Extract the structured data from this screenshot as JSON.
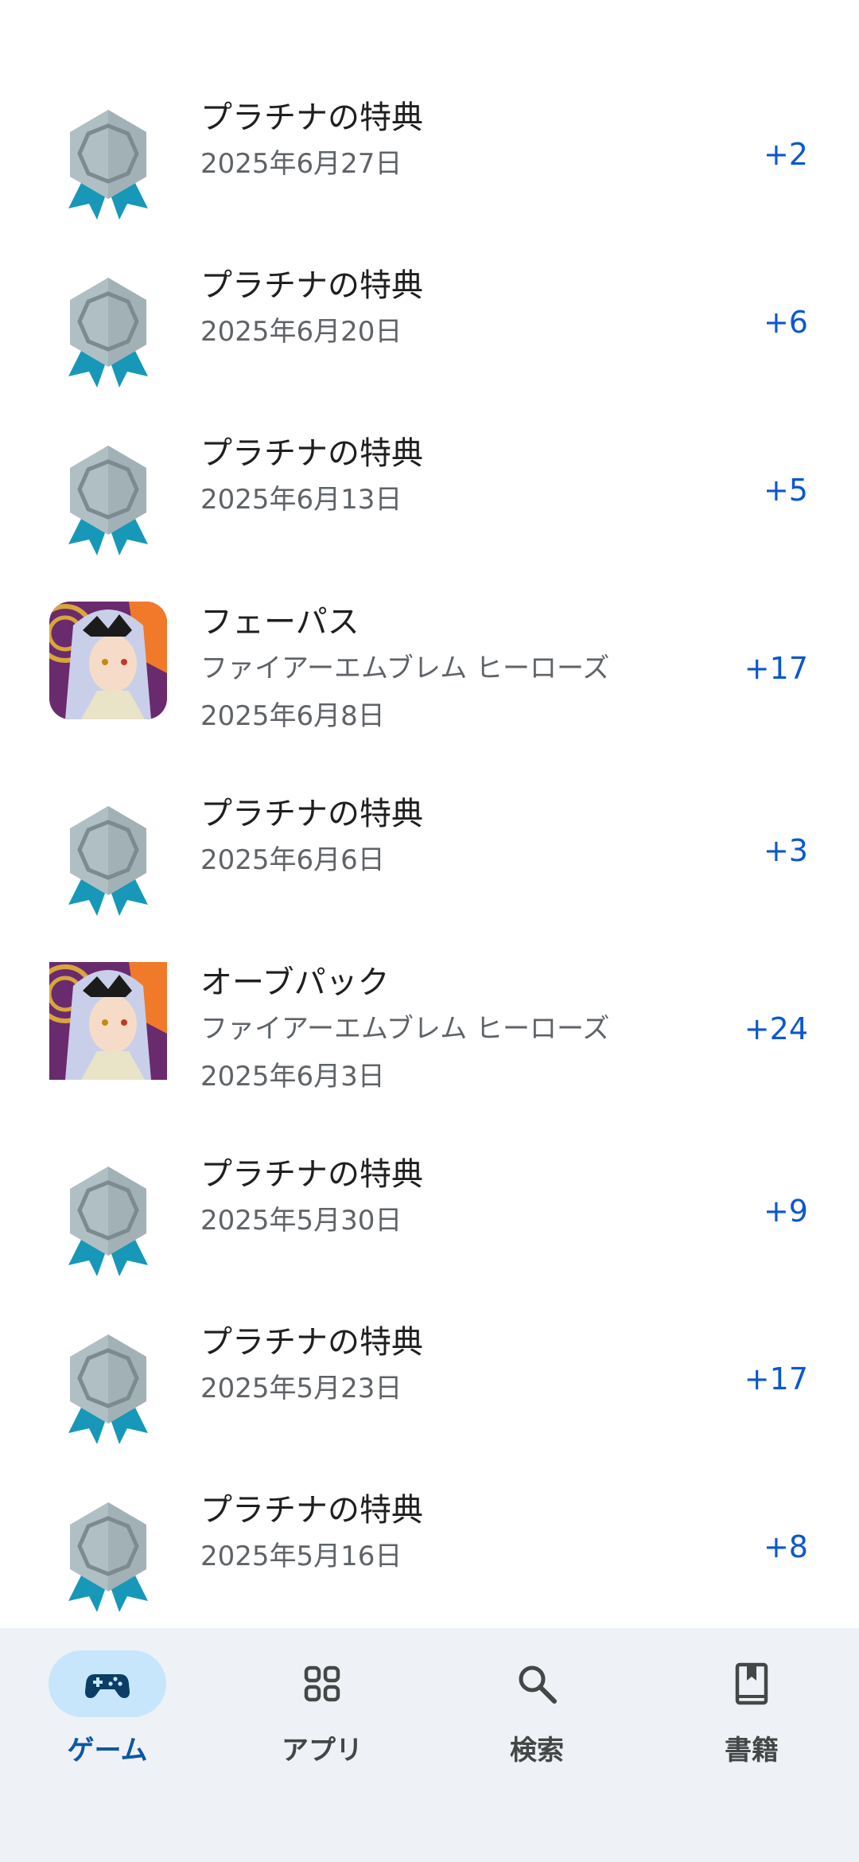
{
  "items": [
    {
      "title": "プラチナの特典",
      "subtitle": "",
      "date": "2025年6月27日",
      "points": "+2",
      "icon": "platinum-medal-icon"
    },
    {
      "title": "プラチナの特典",
      "subtitle": "",
      "date": "2025年6月20日",
      "points": "+6",
      "icon": "platinum-medal-icon"
    },
    {
      "title": "プラチナの特典",
      "subtitle": "",
      "date": "2025年6月13日",
      "points": "+5",
      "icon": "platinum-medal-icon"
    },
    {
      "title": "フェーパス",
      "subtitle": "ファイアーエムブレム ヒーローズ",
      "date": "2025年6月8日",
      "points": "+17",
      "icon": "game-app-icon"
    },
    {
      "title": "プラチナの特典",
      "subtitle": "",
      "date": "2025年6月6日",
      "points": "+3",
      "icon": "platinum-medal-icon"
    },
    {
      "title": "オーブパック",
      "subtitle": "ファイアーエムブレム ヒーローズ",
      "date": "2025年6月3日",
      "points": "+24",
      "icon": "game-app-icon"
    },
    {
      "title": "プラチナの特典",
      "subtitle": "",
      "date": "2025年5月30日",
      "points": "+9",
      "icon": "platinum-medal-icon"
    },
    {
      "title": "プラチナの特典",
      "subtitle": "",
      "date": "2025年5月23日",
      "points": "+17",
      "icon": "platinum-medal-icon"
    },
    {
      "title": "プラチナの特典",
      "subtitle": "",
      "date": "2025年5月16日",
      "points": "+8",
      "icon": "platinum-medal-icon"
    }
  ],
  "nav": {
    "games": "ゲーム",
    "apps": "アプリ",
    "search": "検索",
    "books": "書籍"
  },
  "colors": {
    "points": "#0b57d0",
    "nav_background": "#eef1f6",
    "nav_active_pill": "#c7e6fb",
    "medal_silver": "#b0bfc4",
    "medal_ribbon": "#1798b8"
  }
}
